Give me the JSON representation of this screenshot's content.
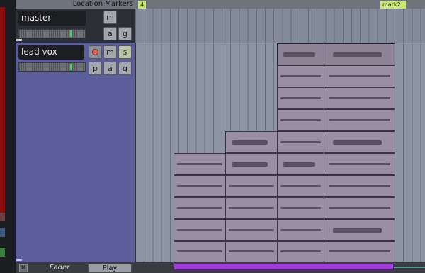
{
  "markers_ruler": {
    "title": "Location Markers",
    "markers": [
      {
        "label": "4"
      },
      {
        "label": "mark2"
      }
    ]
  },
  "tracks": [
    {
      "name": "master",
      "buttons": [
        "m",
        "a",
        "g"
      ]
    },
    {
      "name": "lead vox",
      "buttons": [
        "m",
        "s",
        "p",
        "a",
        "g"
      ]
    }
  ],
  "bottom_bar": {
    "fader_label": "Fader",
    "play_label": "Play",
    "close_label": "✕"
  },
  "colors": {
    "track_color": "#5b5e9a",
    "region_color": "#9a8ea4",
    "range_color": "#9d3fd4",
    "marker_color": "#c9e86e",
    "meter_peak": "#44dd44"
  }
}
